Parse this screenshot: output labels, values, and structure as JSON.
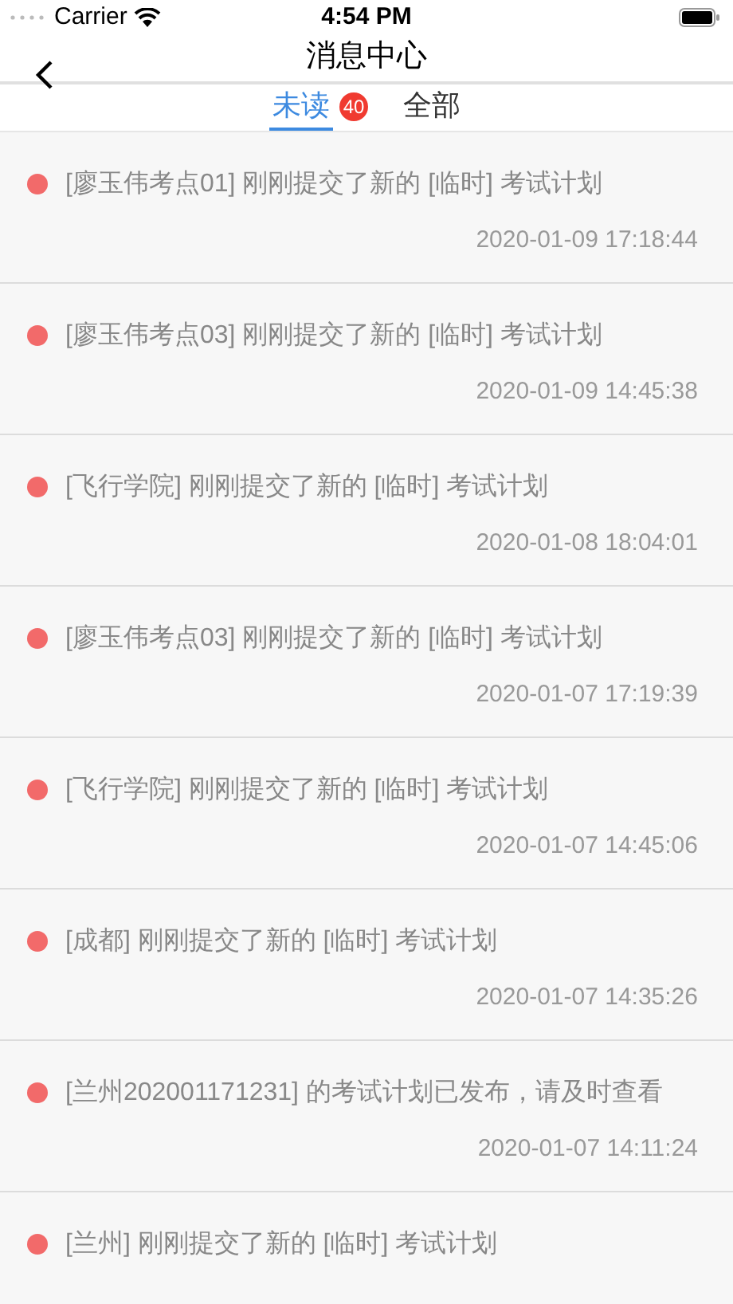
{
  "status_bar": {
    "carrier": "Carrier",
    "time": "4:54 PM"
  },
  "nav": {
    "title": "消息中心"
  },
  "tabs": [
    {
      "label": "未读",
      "selected": true,
      "badge": "40"
    },
    {
      "label": "全部",
      "selected": false
    }
  ],
  "messages": [
    {
      "text": "[廖玉伟考点01] 刚刚提交了新的 [临时] 考试计划",
      "time": "2020-01-09 17:18:44",
      "unread": true
    },
    {
      "text": "[廖玉伟考点03] 刚刚提交了新的 [临时] 考试计划",
      "time": "2020-01-09 14:45:38",
      "unread": true
    },
    {
      "text": "[飞行学院] 刚刚提交了新的 [临时] 考试计划",
      "time": "2020-01-08 18:04:01",
      "unread": true
    },
    {
      "text": "[廖玉伟考点03] 刚刚提交了新的 [临时] 考试计划",
      "time": "2020-01-07 17:19:39",
      "unread": true
    },
    {
      "text": "[飞行学院] 刚刚提交了新的 [临时] 考试计划",
      "time": "2020-01-07 14:45:06",
      "unread": true
    },
    {
      "text": "[成都] 刚刚提交了新的 [临时] 考试计划",
      "time": "2020-01-07 14:35:26",
      "unread": true
    },
    {
      "text": "[兰州202001171231] 的考试计划已发布，请及时查看",
      "time": "2020-01-07 14:11:24",
      "unread": true
    },
    {
      "text": "[兰州] 刚刚提交了新的 [临时] 考试计划",
      "unread": true
    }
  ]
}
